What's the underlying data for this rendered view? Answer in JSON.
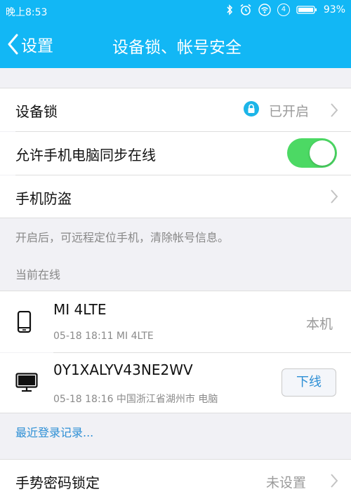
{
  "status_bar": {
    "time": "晚上8:53",
    "notification_count": "4",
    "battery": "93%",
    "icons": [
      "bluetooth-icon",
      "alarm-icon",
      "wifi-icon",
      "notification-badge-icon",
      "battery-icon"
    ]
  },
  "nav": {
    "back_label": "设置",
    "title": "设备锁、帐号安全"
  },
  "device_lock": {
    "label": "设备锁",
    "status": "已开启"
  },
  "sync_online": {
    "label": "允许手机电脑同步在线",
    "enabled": true
  },
  "anti_theft": {
    "label": "手机防盗",
    "note": "开启后，可远程定位手机，清除帐号信息。"
  },
  "online_section": {
    "header": "当前在线",
    "devices": [
      {
        "name": "MI 4LTE",
        "detail": "05-18 18:11 MI 4LTE",
        "tag": "本机",
        "icon": "phone-icon"
      },
      {
        "name": "0Y1XALYV43NE2WV",
        "detail": "05-18 18:16 中国浙江省湖州市 电脑",
        "action": "下线",
        "icon": "computer-icon"
      }
    ]
  },
  "recent_login_link": "最近登录记录...",
  "gesture_lock": {
    "label": "手势密码锁定",
    "status": "未设置"
  },
  "colors": {
    "accent": "#12b7f5",
    "toggle_on": "#4cd964",
    "link": "#2d8fd5",
    "lock_badge": "#1cb5e8"
  }
}
